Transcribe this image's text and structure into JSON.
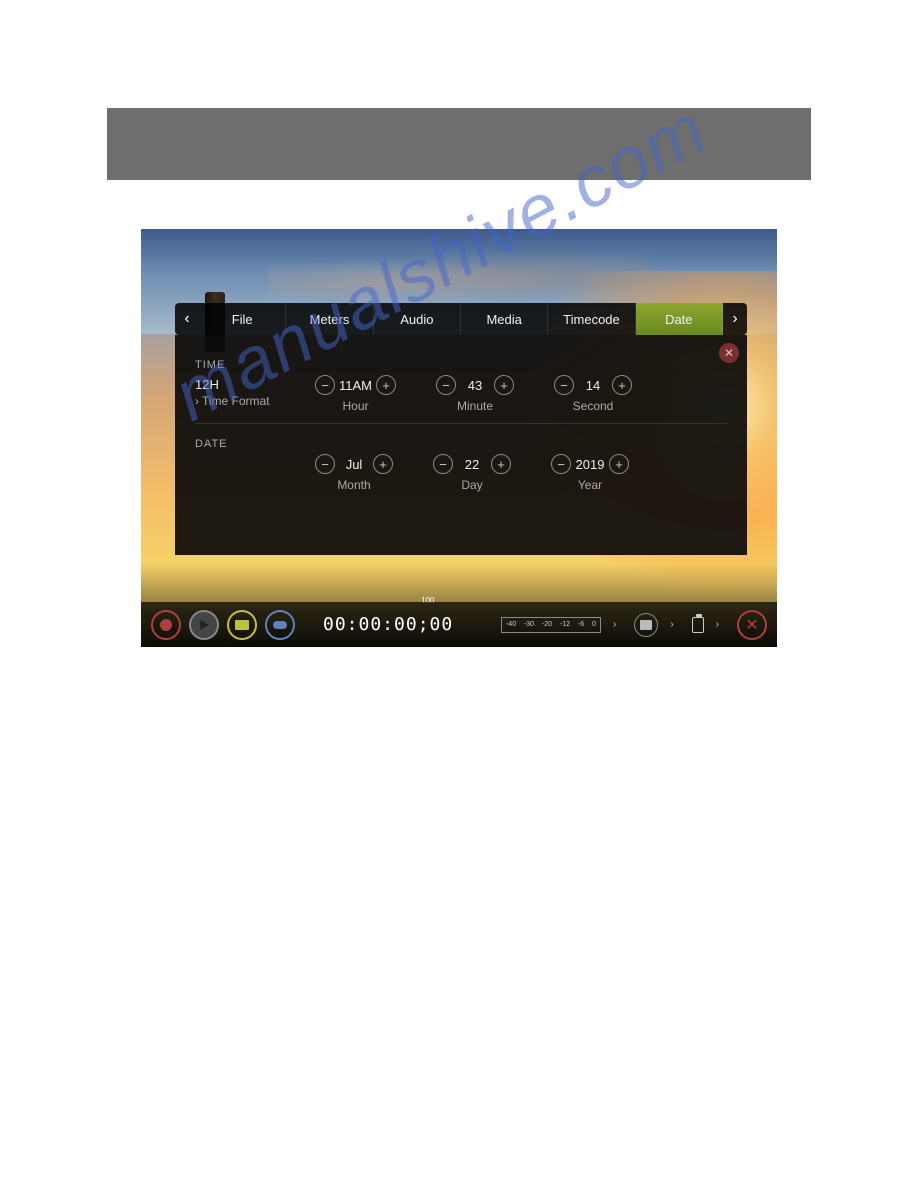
{
  "tabs": {
    "items": [
      "File",
      "Meters",
      "Audio",
      "Media",
      "Timecode",
      "Date"
    ],
    "active": "Date"
  },
  "panel": {
    "time": {
      "label": "TIME",
      "format_value": "12H",
      "format_label": "Time Format",
      "hour": {
        "value": "11AM",
        "label": "Hour"
      },
      "minute": {
        "value": "43",
        "label": "Minute"
      },
      "second": {
        "value": "14",
        "label": "Second"
      }
    },
    "date": {
      "label": "DATE",
      "month": {
        "value": "Jul",
        "label": "Month"
      },
      "day": {
        "value": "22",
        "label": "Day"
      },
      "year": {
        "value": "2019",
        "label": "Year"
      }
    }
  },
  "toolbar": {
    "timecode": "00:00:00;00",
    "small_num": "100",
    "meter_ticks": [
      "-40",
      "-30",
      "-20",
      "-12",
      "-6",
      "0"
    ]
  },
  "watermark": "manualshive.com"
}
